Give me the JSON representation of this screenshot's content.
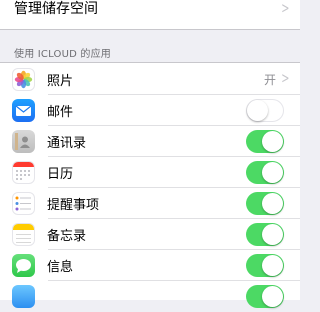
{
  "storage": {
    "label": "管理储存空间"
  },
  "section": {
    "header": "使用 ICLOUD 的应用"
  },
  "apps": [
    {
      "label": "照片",
      "value": "开",
      "state": "link",
      "icon": "photos-icon"
    },
    {
      "label": "邮件",
      "state": "off",
      "icon": "mail-icon"
    },
    {
      "label": "通讯录",
      "state": "on",
      "icon": "contacts-icon"
    },
    {
      "label": "日历",
      "state": "on",
      "icon": "calendar-icon"
    },
    {
      "label": "提醒事项",
      "state": "on",
      "icon": "reminders-icon"
    },
    {
      "label": "备忘录",
      "state": "on",
      "icon": "notes-icon"
    },
    {
      "label": "信息",
      "state": "on",
      "icon": "messages-icon"
    },
    {
      "state": "on",
      "icon": "app-icon"
    }
  ],
  "colors": {
    "switch_on": "#4cd964",
    "background": "#efeff4"
  }
}
